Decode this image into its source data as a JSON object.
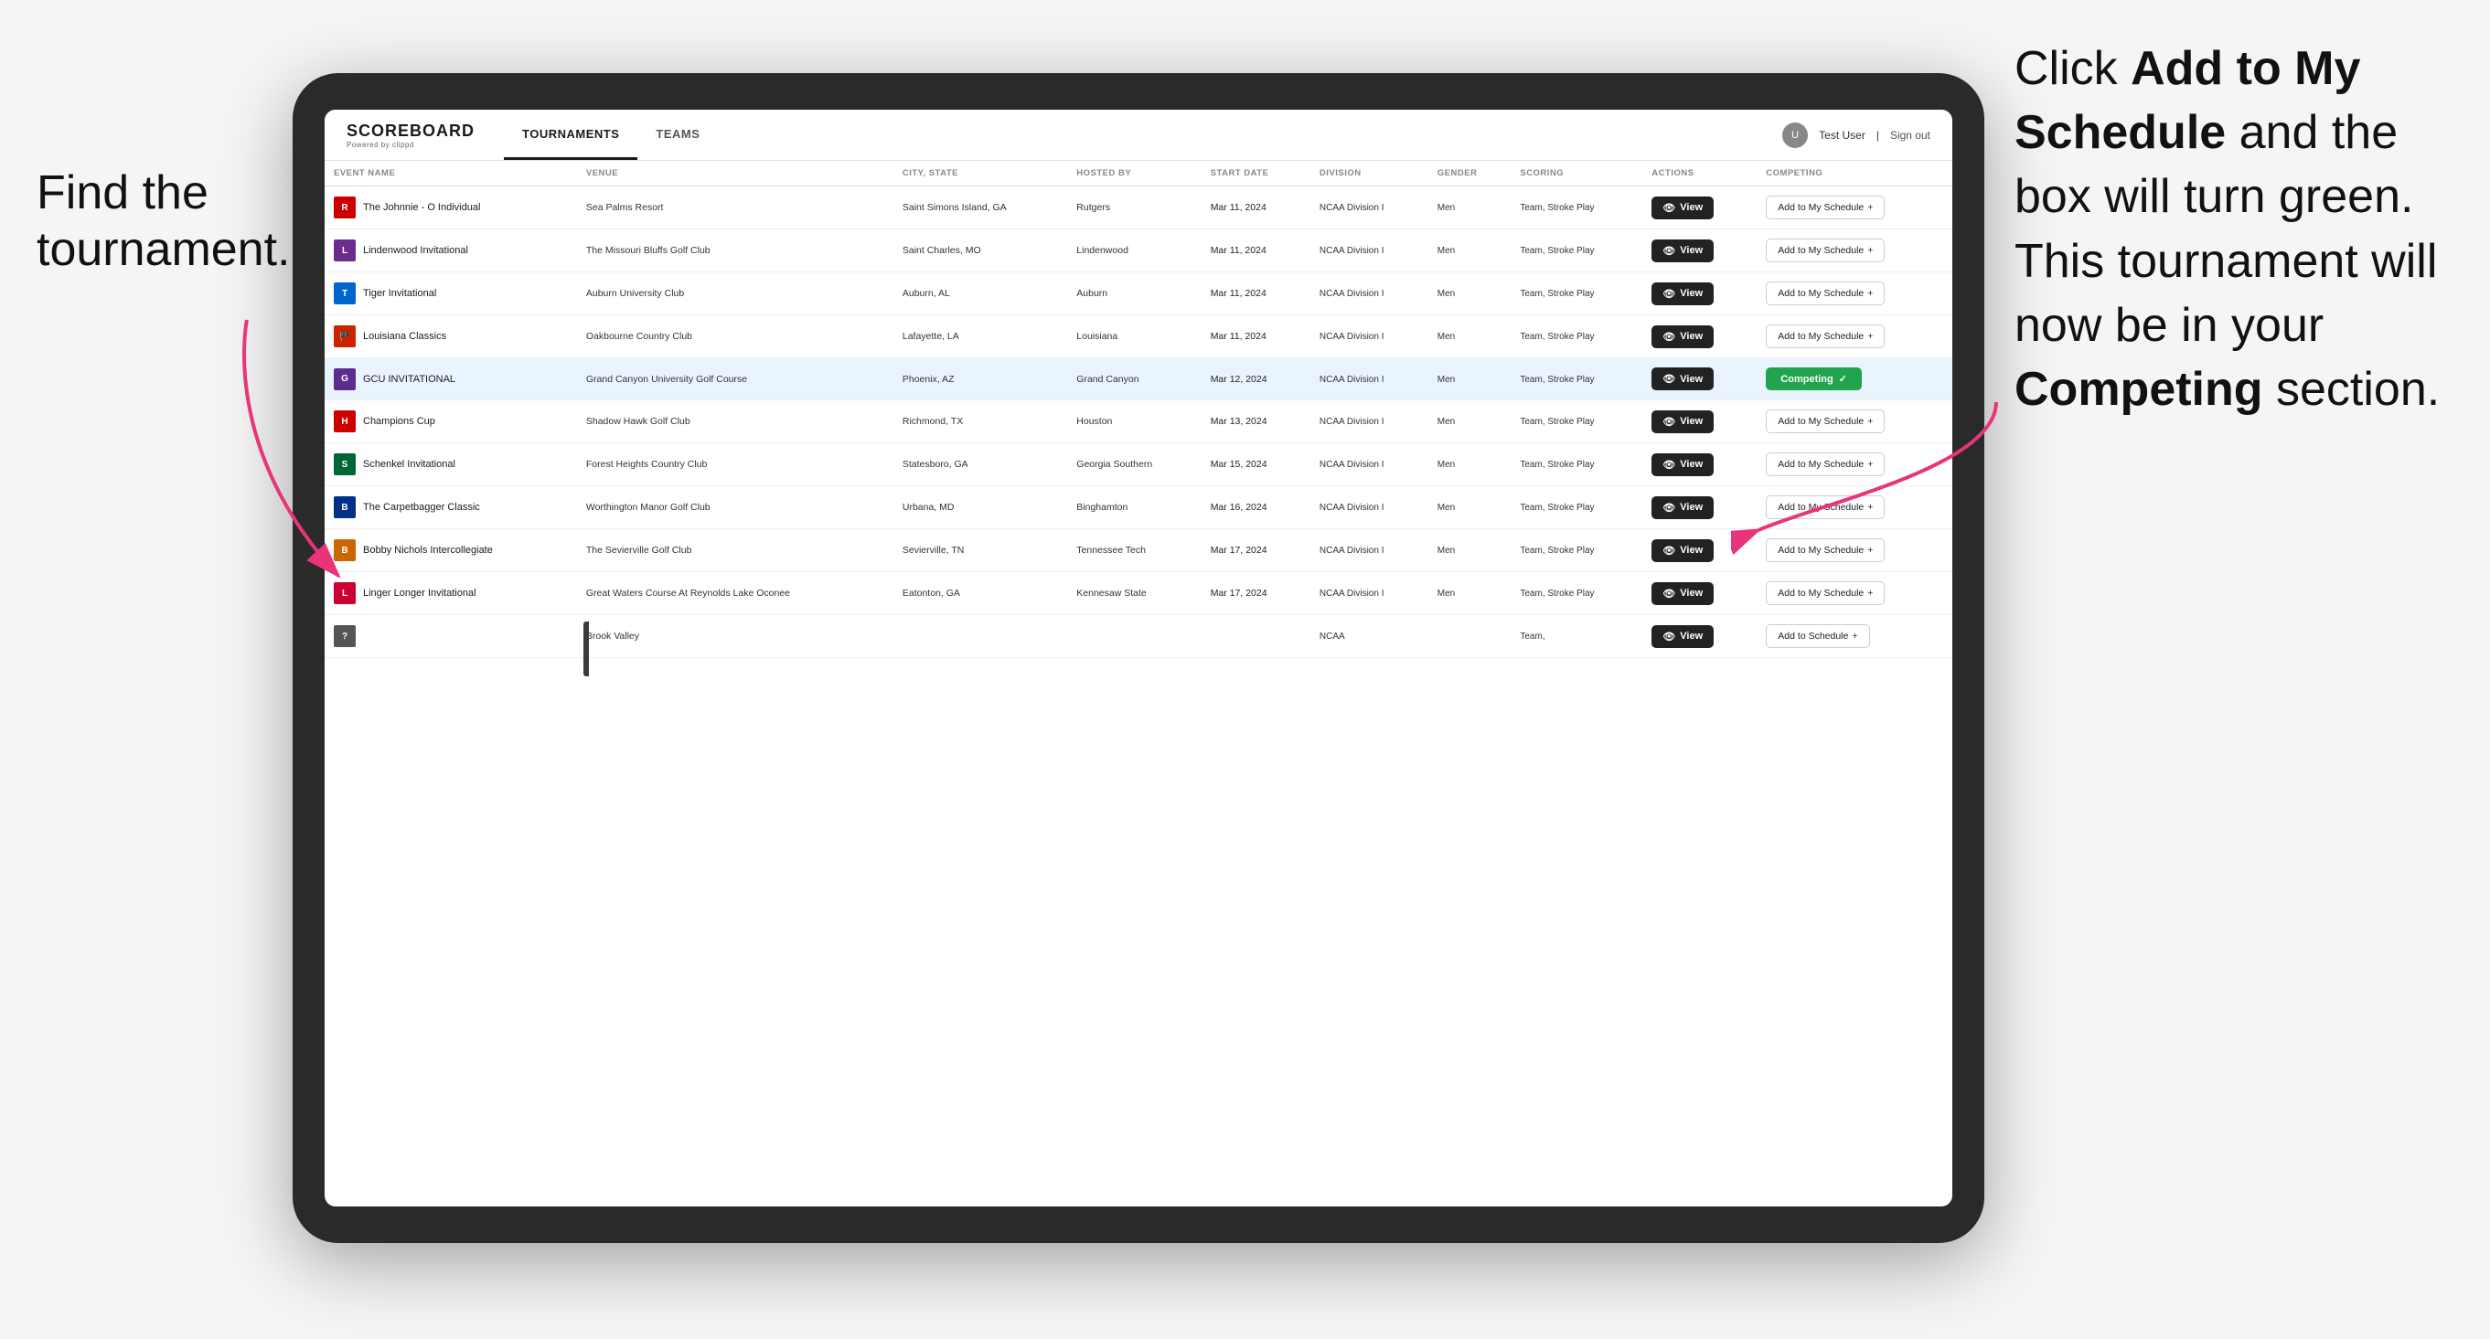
{
  "annotations": {
    "left": "Find the\ntournament.",
    "right_line1": "Click ",
    "right_bold1": "Add to My\nSchedule",
    "right_line2": " and the\nbox will turn green.\nThis tournament\nwill now be in\nyour ",
    "right_bold2": "Competing",
    "right_line3": "\nsection."
  },
  "app": {
    "logo": "SCOREBOARD",
    "logo_sub": "Powered by clippd",
    "nav": [
      "TOURNAMENTS",
      "TEAMS"
    ],
    "active_nav": "TOURNAMENTS",
    "user": "Test User",
    "sign_out": "Sign out"
  },
  "table": {
    "columns": [
      "EVENT NAME",
      "VENUE",
      "CITY, STATE",
      "HOSTED BY",
      "START DATE",
      "DIVISION",
      "GENDER",
      "SCORING",
      "ACTIONS",
      "COMPETING"
    ],
    "rows": [
      {
        "logo_color": "#cc0000",
        "logo_letter": "R",
        "event": "The Johnnie - O Individual",
        "venue": "Sea Palms Resort",
        "city": "Saint Simons Island, GA",
        "hosted_by": "Rutgers",
        "start_date": "Mar 11, 2024",
        "division": "NCAA Division I",
        "gender": "Men",
        "scoring": "Team, Stroke Play",
        "action_btn": "View",
        "competing_label": "Add to My Schedule",
        "competing_type": "add",
        "highlighted": false
      },
      {
        "logo_color": "#6b2d8b",
        "logo_letter": "L",
        "event": "Lindenwood Invitational",
        "venue": "The Missouri Bluffs Golf Club",
        "city": "Saint Charles, MO",
        "hosted_by": "Lindenwood",
        "start_date": "Mar 11, 2024",
        "division": "NCAA Division I",
        "gender": "Men",
        "scoring": "Team, Stroke Play",
        "action_btn": "View",
        "competing_label": "Add to My Schedule",
        "competing_type": "add",
        "highlighted": false
      },
      {
        "logo_color": "#0066cc",
        "logo_letter": "T",
        "event": "Tiger Invitational",
        "venue": "Auburn University Club",
        "city": "Auburn, AL",
        "hosted_by": "Auburn",
        "start_date": "Mar 11, 2024",
        "division": "NCAA Division I",
        "gender": "Men",
        "scoring": "Team, Stroke Play",
        "action_btn": "View",
        "competing_label": "Add to My Schedule",
        "competing_type": "add",
        "highlighted": false
      },
      {
        "logo_color": "#cc2200",
        "logo_letter": "🏴",
        "event": "Louisiana Classics",
        "venue": "Oakbourne Country Club",
        "city": "Lafayette, LA",
        "hosted_by": "Louisiana",
        "start_date": "Mar 11, 2024",
        "division": "NCAA Division I",
        "gender": "Men",
        "scoring": "Team, Stroke Play",
        "action_btn": "View",
        "competing_label": "Add to My Schedule",
        "competing_type": "add",
        "highlighted": false
      },
      {
        "logo_color": "#5c2d91",
        "logo_letter": "G",
        "event": "GCU INVITATIONAL",
        "venue": "Grand Canyon University Golf Course",
        "city": "Phoenix, AZ",
        "hosted_by": "Grand Canyon",
        "start_date": "Mar 12, 2024",
        "division": "NCAA Division I",
        "gender": "Men",
        "scoring": "Team, Stroke Play",
        "action_btn": "View",
        "competing_label": "Competing",
        "competing_type": "competing",
        "highlighted": true
      },
      {
        "logo_color": "#cc0000",
        "logo_letter": "H",
        "event": "Champions Cup",
        "venue": "Shadow Hawk Golf Club",
        "city": "Richmond, TX",
        "hosted_by": "Houston",
        "start_date": "Mar 13, 2024",
        "division": "NCAA Division I",
        "gender": "Men",
        "scoring": "Team, Stroke Play",
        "action_btn": "View",
        "competing_label": "Add to My Schedule",
        "competing_type": "add",
        "highlighted": false
      },
      {
        "logo_color": "#006633",
        "logo_letter": "S",
        "event": "Schenkel Invitational",
        "venue": "Forest Heights Country Club",
        "city": "Statesboro, GA",
        "hosted_by": "Georgia Southern",
        "start_date": "Mar 15, 2024",
        "division": "NCAA Division I",
        "gender": "Men",
        "scoring": "Team, Stroke Play",
        "action_btn": "View",
        "competing_label": "Add to My Schedule",
        "competing_type": "add",
        "highlighted": false
      },
      {
        "logo_color": "#003087",
        "logo_letter": "B",
        "event": "The Carpetbagger Classic",
        "venue": "Worthington Manor Golf Club",
        "city": "Urbana, MD",
        "hosted_by": "Binghamton",
        "start_date": "Mar 16, 2024",
        "division": "NCAA Division I",
        "gender": "Men",
        "scoring": "Team, Stroke Play",
        "action_btn": "View",
        "competing_label": "Add to My Schedule",
        "competing_type": "add",
        "highlighted": false
      },
      {
        "logo_color": "#cc6600",
        "logo_letter": "B",
        "event": "Bobby Nichols Intercollegiate",
        "venue": "The Sevierville Golf Club",
        "city": "Sevierville, TN",
        "hosted_by": "Tennessee Tech",
        "start_date": "Mar 17, 2024",
        "division": "NCAA Division I",
        "gender": "Men",
        "scoring": "Team, Stroke Play",
        "action_btn": "View",
        "competing_label": "Add to My Schedule",
        "competing_type": "add",
        "highlighted": false
      },
      {
        "logo_color": "#cc0033",
        "logo_letter": "L",
        "event": "Linger Longer Invitational",
        "venue": "Great Waters Course At Reynolds Lake Oconee",
        "city": "Eatonton, GA",
        "hosted_by": "Kennesaw State",
        "start_date": "Mar 17, 2024",
        "division": "NCAA Division I",
        "gender": "Men",
        "scoring": "Team, Stroke Play",
        "action_btn": "View",
        "competing_label": "Add to My Schedule",
        "competing_type": "add",
        "highlighted": false
      },
      {
        "logo_color": "#555",
        "logo_letter": "?",
        "event": "",
        "venue": "Brook Valley",
        "city": "",
        "hosted_by": "",
        "start_date": "",
        "division": "NCAA",
        "gender": "",
        "scoring": "Team,",
        "action_btn": "View",
        "competing_label": "Add to Schedule",
        "competing_type": "add",
        "highlighted": false
      }
    ]
  }
}
